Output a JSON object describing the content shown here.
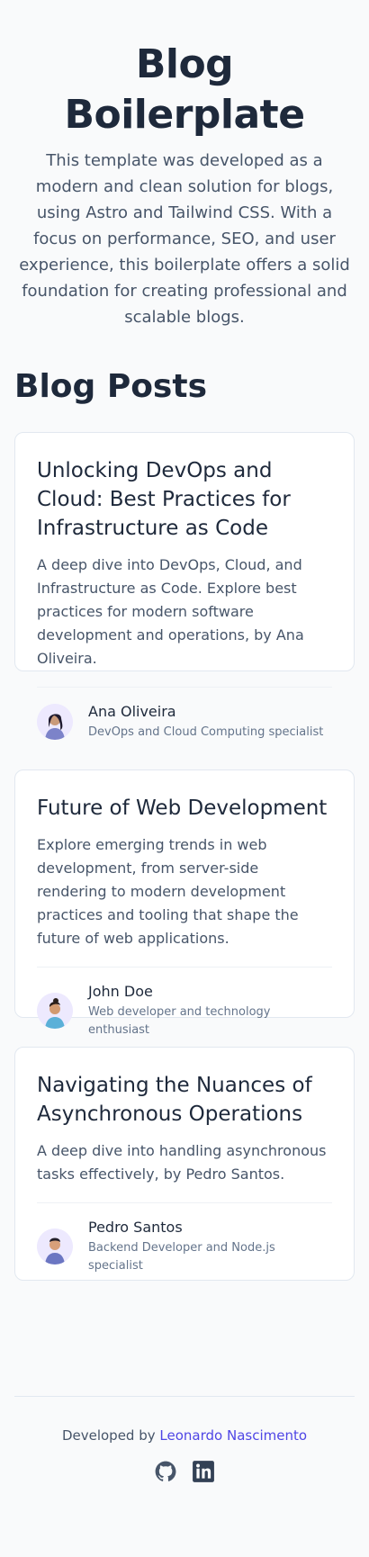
{
  "hero": {
    "title": "Blog Boilerplate",
    "description": "This template was developed as a modern and clean solution for blogs, using Astro and Tailwind CSS. With a focus on performance, SEO, and user experience, this boilerplate offers a solid foundation for creating professional and scalable blogs."
  },
  "posts_section": {
    "title": "Blog Posts"
  },
  "posts": [
    {
      "title": "Unlocking DevOps and Cloud: Best Practices for Infrastructure as Code",
      "excerpt": "A deep dive into DevOps, Cloud, and Infrastructure as Code. Explore best practices for modern software development and operations, by Ana Oliveira.",
      "author_name": "Ana Oliveira",
      "author_role": "DevOps and Cloud Computing specialist"
    },
    {
      "title": "Future of Web Development",
      "excerpt": "Explore emerging trends in web development, from server-side rendering to modern development practices and tooling that shape the future of web applications.",
      "author_name": "John Doe",
      "author_role": "Web developer and technology enthusiast"
    },
    {
      "title": "Navigating the Nuances of Asynchronous Operations",
      "excerpt": "A deep dive into handling asynchronous tasks effectively, by Pedro Santos.",
      "author_name": "Pedro Santos",
      "author_role": "Backend Developer and Node.js specialist"
    }
  ],
  "footer": {
    "prefix": "Developed by",
    "author_link": "Leonardo Nascimento",
    "social": [
      "github-icon",
      "linkedin-icon"
    ]
  },
  "colors": {
    "text": "#1e293b",
    "muted": "#475569",
    "link": "#4f46e5",
    "card_border": "#e2e8f0"
  }
}
